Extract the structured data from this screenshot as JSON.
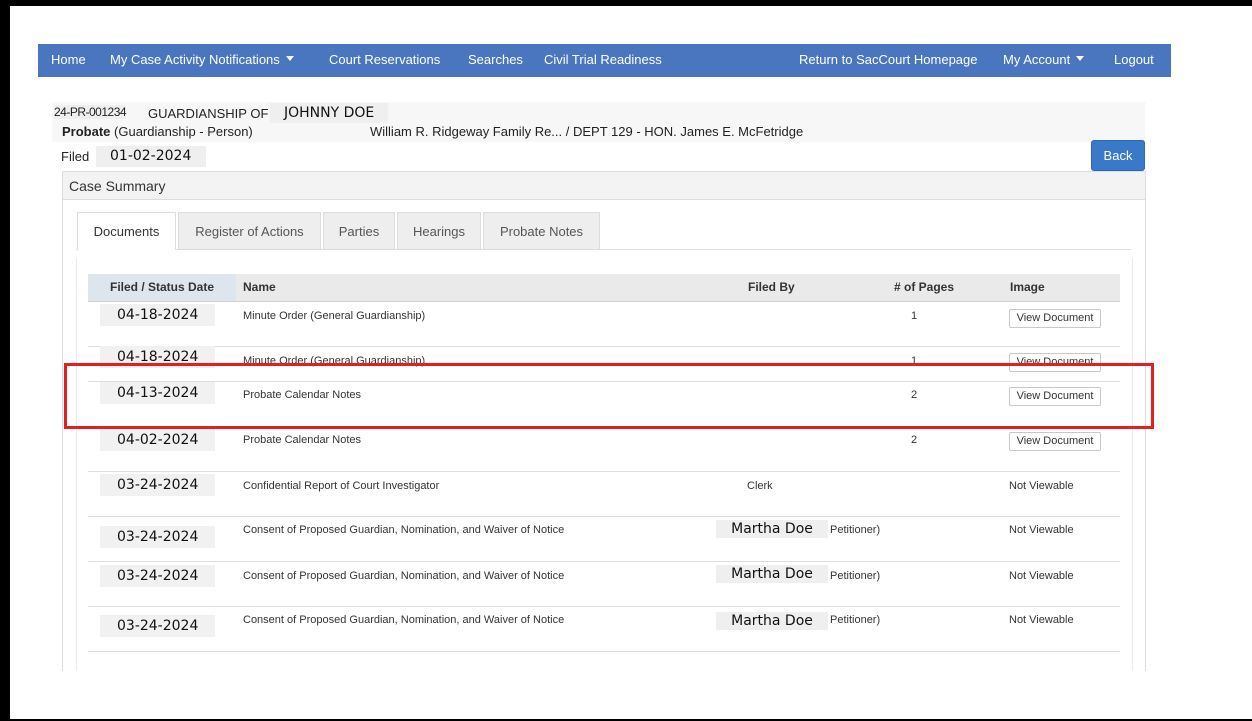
{
  "nav": {
    "items": [
      {
        "label": "Home"
      },
      {
        "label": "My Case Activity Notifications",
        "dropdown": true
      },
      {
        "label": "Court Reservations"
      },
      {
        "label": "Searches"
      },
      {
        "label": "Civil Trial Readiness"
      }
    ],
    "right_items": [
      {
        "label": "Return to SacCourt Homepage"
      },
      {
        "label": "My Account",
        "dropdown": true
      },
      {
        "label": "Logout"
      }
    ],
    "color": "#4a76bf"
  },
  "case": {
    "number": "24-PR-001234",
    "title_prefix": "GUARDIANSHIP OF",
    "title_name": "JOHNNY DOE",
    "type_bold": "Probate",
    "type_rest": "(Guardianship - Person)",
    "court": "William R. Ridgeway Family Re... / DEPT 129 - HON. James E. McFetridge",
    "filed_label": "Filed",
    "filed_date": "01-02-2024"
  },
  "back_label": "Back",
  "summary_title": "Case Summary",
  "tabs": [
    {
      "label": "Documents",
      "active": true
    },
    {
      "label": "Register of Actions"
    },
    {
      "label": "Parties"
    },
    {
      "label": "Hearings"
    },
    {
      "label": "Probate Notes"
    }
  ],
  "table": {
    "headers": {
      "date": "Filed / Status Date",
      "name": "Name",
      "filed_by": "Filed By",
      "pages": "# of Pages",
      "image": "Image"
    },
    "rows": [
      {
        "date": "04-18-2024",
        "name": "Minute Order (General Guardianship)",
        "filed_by": "",
        "filed_by_suffix": "",
        "pages": "1",
        "image": "View Document"
      },
      {
        "date": "04-18-2024",
        "name": "Minute Order (General Guardianship)",
        "filed_by": "",
        "filed_by_suffix": "",
        "pages": "1",
        "image": "View Document"
      },
      {
        "date": "04-13-2024",
        "name": "Probate Calendar Notes",
        "filed_by": "",
        "filed_by_suffix": "",
        "pages": "2",
        "image": "View Document"
      },
      {
        "date": "04-02-2024",
        "name": "Probate Calendar Notes",
        "filed_by": "",
        "filed_by_suffix": "",
        "pages": "2",
        "image": "View Document"
      },
      {
        "date": "03-24-2024",
        "name": "Confidential Report of Court Investigator",
        "filed_by": "Clerk",
        "filed_by_suffix": "",
        "pages": "",
        "image": "Not Viewable"
      },
      {
        "date": "03-24-2024",
        "name": "Consent of Proposed Guardian, Nomination, and Waiver of Notice",
        "filed_by": "Martha Doe",
        "filed_by_suffix": "Petitioner)",
        "pages": "",
        "image": "Not Viewable"
      },
      {
        "date": "03-24-2024",
        "name": "Consent of Proposed Guardian, Nomination, and Waiver of Notice",
        "filed_by": "Martha Doe",
        "filed_by_suffix": "Petitioner)",
        "pages": "",
        "image": "Not Viewable"
      },
      {
        "date": "03-24-2024",
        "name": "Consent of Proposed Guardian, Nomination, and Waiver of Notice",
        "filed_by": "Martha Doe",
        "filed_by_suffix": "Petitioner)",
        "pages": "",
        "image": "Not Viewable"
      }
    ]
  },
  "highlight_color": "#e41f1f"
}
